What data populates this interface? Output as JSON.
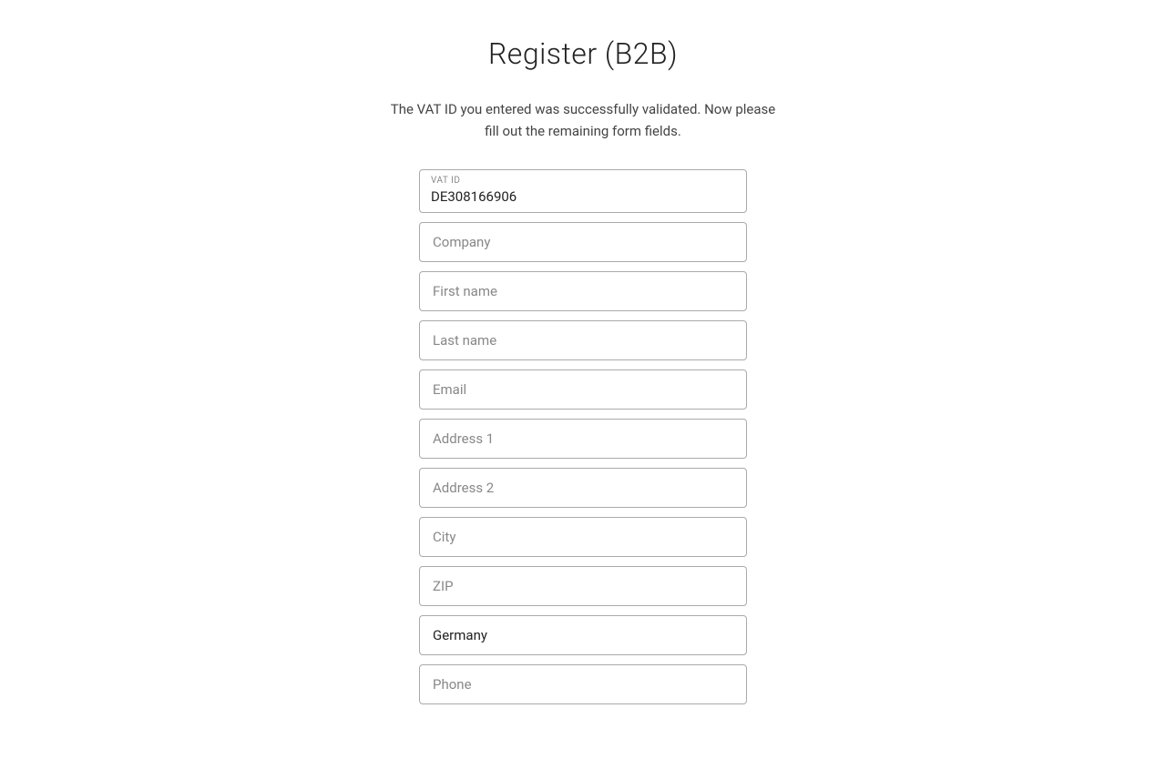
{
  "page": {
    "title": "Register (B2B)",
    "subtitle_line1": "The VAT ID you entered was successfully validated. Now please",
    "subtitle_line2": "fill out the remaining form fields."
  },
  "vat_field": {
    "label": "VAT ID",
    "value": "DE308166906"
  },
  "fields": [
    {
      "id": "company",
      "placeholder": "Company",
      "type": "text",
      "value": ""
    },
    {
      "id": "first-name",
      "placeholder": "First name",
      "type": "text",
      "value": ""
    },
    {
      "id": "last-name",
      "placeholder": "Last name",
      "type": "text",
      "value": ""
    },
    {
      "id": "email",
      "placeholder": "Email",
      "type": "email",
      "value": ""
    },
    {
      "id": "address1",
      "placeholder": "Address 1",
      "type": "text",
      "value": ""
    },
    {
      "id": "address2",
      "placeholder": "Address 2",
      "type": "text",
      "value": ""
    },
    {
      "id": "city",
      "placeholder": "City",
      "type": "text",
      "value": ""
    },
    {
      "id": "zip",
      "placeholder": "ZIP",
      "type": "text",
      "value": ""
    },
    {
      "id": "country",
      "placeholder": "Germany",
      "type": "text",
      "value": "Germany"
    },
    {
      "id": "phone",
      "placeholder": "Phone",
      "type": "tel",
      "value": ""
    }
  ]
}
